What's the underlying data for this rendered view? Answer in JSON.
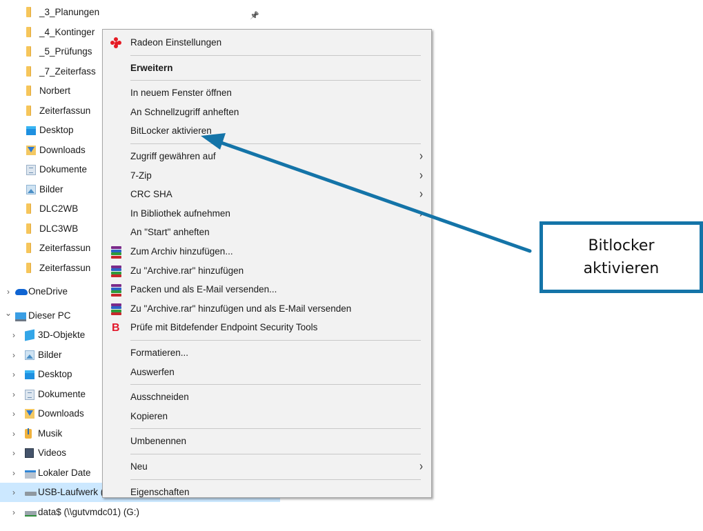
{
  "nav": {
    "top_cut_text": "... ... ... ... ... ... ...",
    "items": [
      {
        "label": "_3_Planungen",
        "icon": "folder-icon",
        "pinned": true
      },
      {
        "label": "_4_Kontinger",
        "icon": "folder-icon"
      },
      {
        "label": "_5_Prüfungs",
        "icon": "folder-icon"
      },
      {
        "label": "_7_Zeiterfass",
        "icon": "folder-icon"
      },
      {
        "label": "Norbert",
        "icon": "folder-icon"
      },
      {
        "label": "Zeiterfassun",
        "icon": "folder-icon"
      },
      {
        "label": "Desktop",
        "icon": "desktop-icon"
      },
      {
        "label": "Downloads",
        "icon": "downloads-icon"
      },
      {
        "label": "Dokumente",
        "icon": "documents-icon"
      },
      {
        "label": "Bilder",
        "icon": "pictures-icon"
      },
      {
        "label": "DLC2WB",
        "icon": "folder-icon"
      },
      {
        "label": "DLC3WB",
        "icon": "folder-icon"
      },
      {
        "label": "Zeiterfassun",
        "icon": "folder-icon"
      },
      {
        "label": "Zeiterfassun",
        "icon": "folder-icon"
      },
      {
        "label": "OneDrive",
        "icon": "onedrive-icon",
        "expandable": true
      },
      {
        "label": "Dieser PC",
        "icon": "this-pc-icon",
        "expanded": true
      },
      {
        "label": "3D-Objekte",
        "icon": "3d-objects-icon",
        "expandable": true
      },
      {
        "label": "Bilder",
        "icon": "pictures-icon",
        "expandable": true
      },
      {
        "label": "Desktop",
        "icon": "desktop-icon",
        "expandable": true
      },
      {
        "label": "Dokumente",
        "icon": "documents-icon",
        "expandable": true
      },
      {
        "label": "Downloads",
        "icon": "downloads-icon",
        "expandable": true
      },
      {
        "label": "Musik",
        "icon": "music-icon",
        "expandable": true
      },
      {
        "label": "Videos",
        "icon": "videos-icon",
        "expandable": true
      },
      {
        "label": "Lokaler Date",
        "icon": "local-disk-icon",
        "expandable": true
      },
      {
        "label": "USB-Laufwerk (D:)",
        "icon": "usb-drive-icon",
        "expandable": true,
        "selected": true
      },
      {
        "label": "data$ (\\\\gutvmdc01) (G:)",
        "icon": "network-drive-icon",
        "expandable": true
      }
    ]
  },
  "context_menu": {
    "items": [
      {
        "label": "Radeon Einstellungen",
        "icon": "radeon-icon"
      },
      {
        "separator": true
      },
      {
        "label": "Erweitern",
        "bold": true
      },
      {
        "separator": true
      },
      {
        "label": "In neuem Fenster öffnen"
      },
      {
        "label": "An Schnellzugriff anheften"
      },
      {
        "label": "BitLocker aktivieren"
      },
      {
        "separator": true
      },
      {
        "label": "Zugriff gewähren auf",
        "submenu": true
      },
      {
        "label": "7-Zip",
        "submenu": true
      },
      {
        "label": "CRC SHA",
        "submenu": true
      },
      {
        "label": "In Bibliothek aufnehmen",
        "submenu": true
      },
      {
        "label": "An \"Start\" anheften"
      },
      {
        "label": "Zum Archiv hinzufügen...",
        "icon": "winrar-icon"
      },
      {
        "label": "Zu \"Archive.rar\" hinzufügen",
        "icon": "winrar-icon"
      },
      {
        "label": "Packen und als E-Mail versenden...",
        "icon": "winrar-icon"
      },
      {
        "label": "Zu \"Archive.rar\" hinzufügen und als E-Mail versenden",
        "icon": "winrar-icon"
      },
      {
        "label": "Prüfe mit Bitdefender Endpoint Security Tools",
        "icon": "bitdefender-icon"
      },
      {
        "separator": true
      },
      {
        "label": "Formatieren..."
      },
      {
        "label": "Auswerfen"
      },
      {
        "separator": true
      },
      {
        "label": "Ausschneiden"
      },
      {
        "label": "Kopieren"
      },
      {
        "separator": true
      },
      {
        "label": "Umbenennen"
      },
      {
        "separator": true
      },
      {
        "label": "Neu",
        "submenu": true
      },
      {
        "separator": true
      },
      {
        "label": "Eigenschaften"
      }
    ],
    "submenu_glyph": "›"
  },
  "annotation": {
    "line1": "Bitlocker",
    "line2": "aktivieren",
    "color": "#1474a8"
  },
  "colors": {
    "menu_bg": "#f2f2f2",
    "selection": "#cce8ff",
    "separator": "#c8c8c8"
  }
}
